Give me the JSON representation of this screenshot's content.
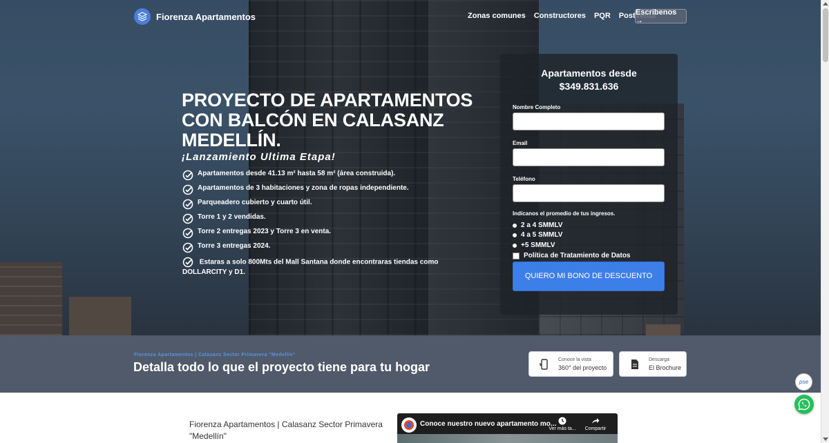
{
  "nav": {
    "brand": "Fiorenza Apartamentos",
    "links": [
      "Zonas comunes",
      "Constructores",
      "PQR",
      "PostVenta"
    ],
    "cta": "Escribenos →"
  },
  "hero": {
    "title": "PROYECTO DE APARTAMENTOS CON BALCÓN EN CALASANZ MEDELLÍN.",
    "subtitle": "¡Lanzamiento Ultima Etapa!",
    "features": [
      "Apartamentos desde 41.13 m² hasta 58 m² (área construida).",
      "Apartamentos de 3 habitaciones y zona de ropas independiente.",
      "Parqueadero cubierto y cuarto útil.",
      "Torre 1 y 2 vendidas.",
      "Torre 2 entregas 2023 y Torre 3 en venta.",
      "Torre 3 entregas 2024.",
      "Estaras a solo 800Mts del Mall Santana donde encontraras tiendas como DOLLARCITY y D1."
    ]
  },
  "form": {
    "heading_line1": "Apartamentos desde",
    "heading_line2": "$349.831.636",
    "name_label": "Nombre Completo",
    "email_label": "Email",
    "phone_label": "Teléfono",
    "income_question": "Indícanos el promedio de tus ingresos.",
    "income_options": [
      "2 a 4 SMMLV",
      "4 a 5 SMMLV",
      "+5 SMMLV"
    ],
    "privacy_label": "Política de Tratamiento de Datos",
    "submit": "QUIERO MI BONO DE DESCUENTO"
  },
  "band": {
    "breadcrumb": "Fiorenza Apartamentos |  Calasanz Sector Primavera \"Medellín\"",
    "title": "Detalla todo lo que el proyecto tiene para tu hogar",
    "btn_360_small": "Conoce la vista",
    "btn_360_big": "360° del proyecto",
    "btn_brochure_small": "Descarga",
    "btn_brochure_big": "El Brochure"
  },
  "bottom": {
    "text": "Fiorenza Apartamentos |  Calasanz Sector Primavera \"Medellín\"",
    "video_title": "Conoce nuestro nuevo apartamento mo...",
    "video_watch_later": "Ver más ta...",
    "video_share": "Compartir"
  },
  "floating": {
    "pse": "pse"
  },
  "colors": {
    "accent": "#3d7fe8",
    "band_bg": "#505a6a",
    "whatsapp": "#25c05a"
  }
}
